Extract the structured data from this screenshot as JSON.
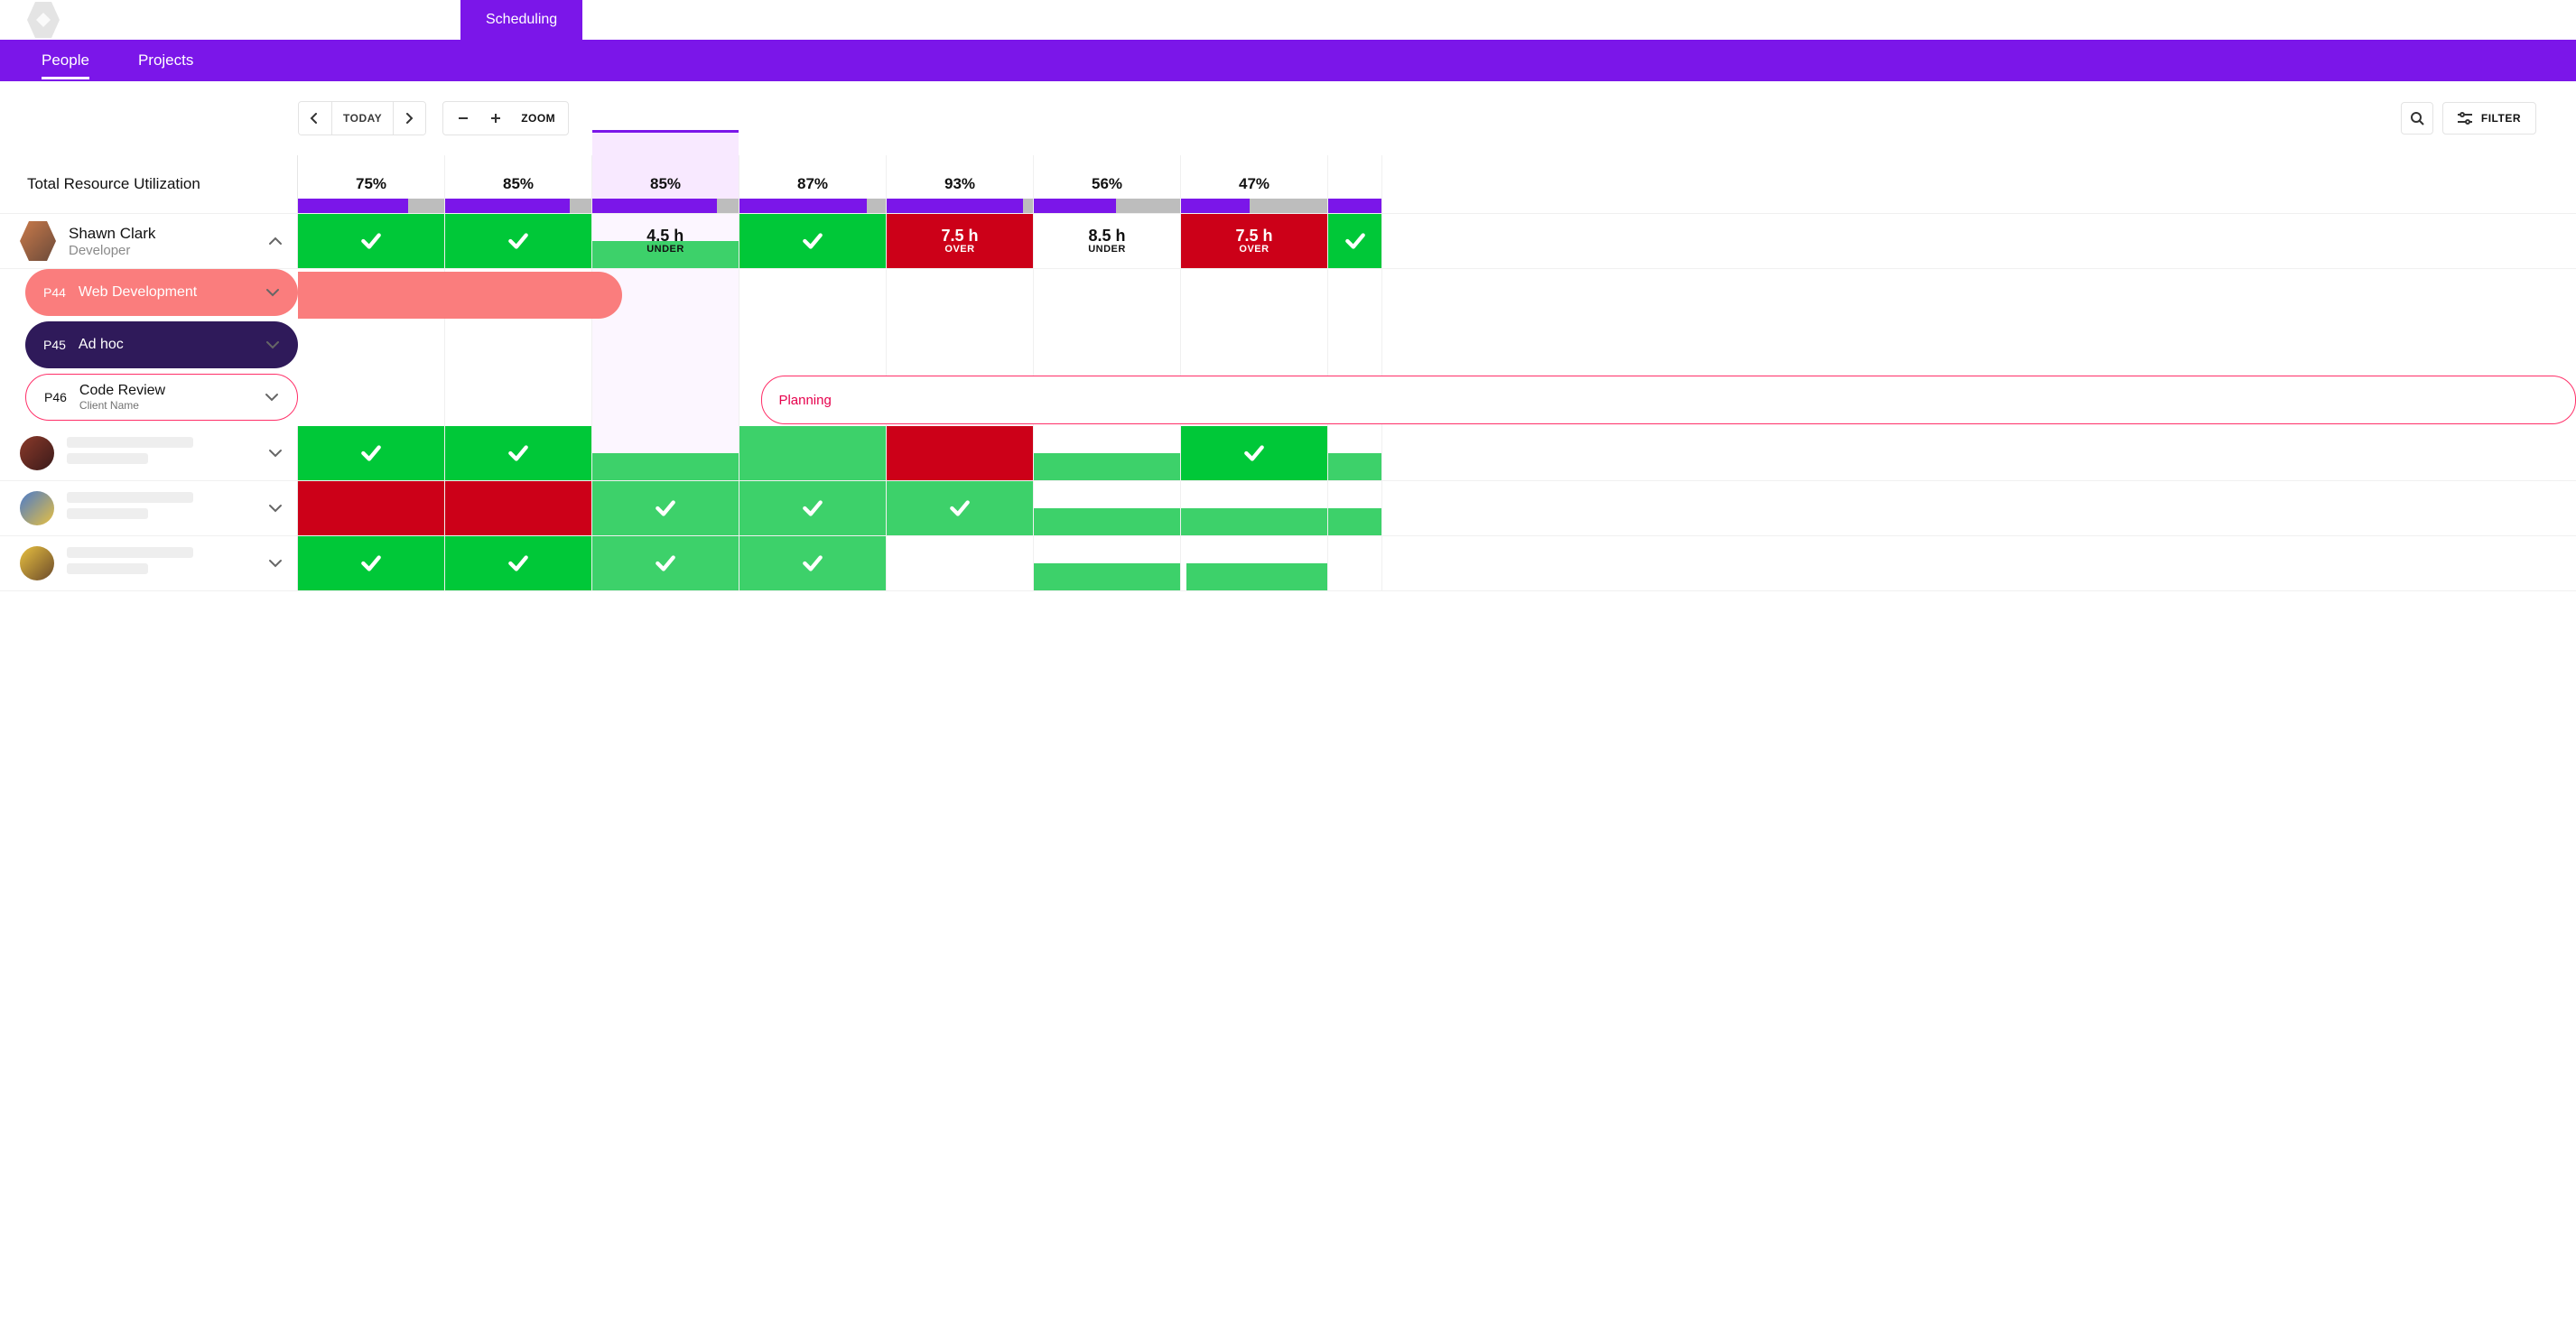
{
  "app": {
    "tab_scheduling": "Scheduling"
  },
  "nav": {
    "people": "People",
    "projects": "Projects"
  },
  "toolbar": {
    "today": "TODAY",
    "zoom": "ZOOM",
    "filter": "FILTER"
  },
  "header": {
    "title": "Total Resource Utilization"
  },
  "columns": [
    {
      "pct": "75%",
      "fill": 75,
      "current": false
    },
    {
      "pct": "85%",
      "fill": 85,
      "current": false
    },
    {
      "pct": "85%",
      "fill": 85,
      "current": true
    },
    {
      "pct": "87%",
      "fill": 87,
      "current": false
    },
    {
      "pct": "93%",
      "fill": 93,
      "current": false
    },
    {
      "pct": "56%",
      "fill": 56,
      "current": false
    },
    {
      "pct": "47%",
      "fill": 47,
      "current": false
    }
  ],
  "people": [
    {
      "name": "Shawn Clark",
      "role": "Developer",
      "expanded": true,
      "cells": [
        {
          "status": "ok"
        },
        {
          "status": "ok"
        },
        {
          "status": "under",
          "hours": "4.5 h",
          "sub": "UNDER",
          "half": "light"
        },
        {
          "status": "ok"
        },
        {
          "status": "over",
          "hours": "7.5 h",
          "sub": "OVER"
        },
        {
          "status": "under-plain",
          "hours": "8.5 h",
          "sub": "UNDER"
        },
        {
          "status": "over",
          "hours": "7.5 h",
          "sub": "OVER"
        }
      ],
      "tail_extra": "ok",
      "projects": [
        {
          "code": "P44",
          "name": "Web Development",
          "style": "coral",
          "bar_span": [
            0,
            2.2
          ]
        },
        {
          "code": "P45",
          "name": "Ad hoc",
          "style": "navy"
        },
        {
          "code": "P46",
          "name": "Code Review",
          "client": "Client Name",
          "style": "outline",
          "plan_label": "Planning",
          "plan_from": 3.15
        }
      ]
    },
    {
      "placeholder": true,
      "avatar": "a2",
      "cells": [
        {
          "status": "ok"
        },
        {
          "status": "ok"
        },
        {
          "status": "half-light-bottom"
        },
        {
          "status": "light-block"
        },
        {
          "status": "over-block"
        },
        {
          "status": "half-light-bottom"
        },
        {
          "status": "ok"
        }
      ],
      "tail_extra": "half-light"
    },
    {
      "placeholder": true,
      "avatar": "a3",
      "cells": [
        {
          "status": "over-block"
        },
        {
          "status": "over-block"
        },
        {
          "status": "ok-light-check"
        },
        {
          "status": "ok-light-check"
        },
        {
          "status": "ok-light-check"
        },
        {
          "status": "half-light-bottom"
        },
        {
          "status": "half-light-bottom"
        }
      ],
      "tail_extra": "half-light"
    },
    {
      "placeholder": true,
      "avatar": "a4",
      "cells": [
        {
          "status": "ok"
        },
        {
          "status": "ok"
        },
        {
          "status": "ok-light-check"
        },
        {
          "status": "ok-light-check"
        },
        {
          "status": "none"
        },
        {
          "status": "half-light-bottom"
        },
        {
          "status": "half-light-bottom",
          "leftpad": true
        }
      ],
      "tail_extra": "none"
    }
  ]
}
